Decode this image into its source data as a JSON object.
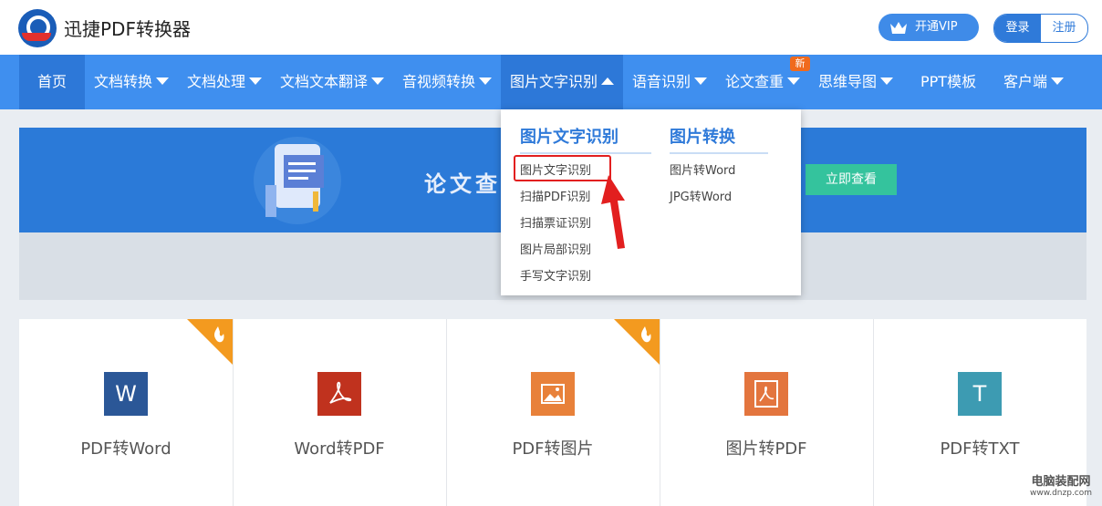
{
  "app": {
    "title": "迅捷PDF转换器"
  },
  "header": {
    "vip_label": "开通VIP",
    "login_label": "登录",
    "register_label": "注册"
  },
  "nav": {
    "items": [
      {
        "label": "首页"
      },
      {
        "label": "文档转换"
      },
      {
        "label": "文档处理"
      },
      {
        "label": "文档文本翻译"
      },
      {
        "label": "音视频转换"
      },
      {
        "label": "图片文字识别"
      },
      {
        "label": "语音识别"
      },
      {
        "label": "论文查重"
      },
      {
        "label": "思维导图"
      },
      {
        "label": "PPT模板"
      },
      {
        "label": "客户端"
      }
    ],
    "new_badge": "新"
  },
  "dropdown": {
    "col1": {
      "heading": "图片文字识别",
      "items": [
        "图片文字识别",
        "扫描PDF识别",
        "扫描票证识别",
        "图片局部识别",
        "手写文字识别"
      ]
    },
    "col2": {
      "heading": "图片转换",
      "items": [
        "图片转Word",
        "JPG转Word"
      ]
    }
  },
  "banner": {
    "headline": "论文查",
    "button": "立即查看"
  },
  "tools": [
    {
      "name": "PDF转Word",
      "icon": "W",
      "color": "#2b5797",
      "hot": true
    },
    {
      "name": "Word转PDF",
      "icon": "pdf-icon",
      "color": "#c0321e",
      "hot": false
    },
    {
      "name": "PDF转图片",
      "icon": "image-icon",
      "color": "#e8813a",
      "hot": true
    },
    {
      "name": "图片转PDF",
      "icon": "pdf-icon",
      "color": "#e3753e",
      "hot": false
    },
    {
      "name": "PDF转TXT",
      "icon": "T",
      "color": "#3d9bb2",
      "hot": false
    }
  ],
  "watermark": {
    "line1": "电脑装配网",
    "line2": "www.dnzp.com"
  }
}
